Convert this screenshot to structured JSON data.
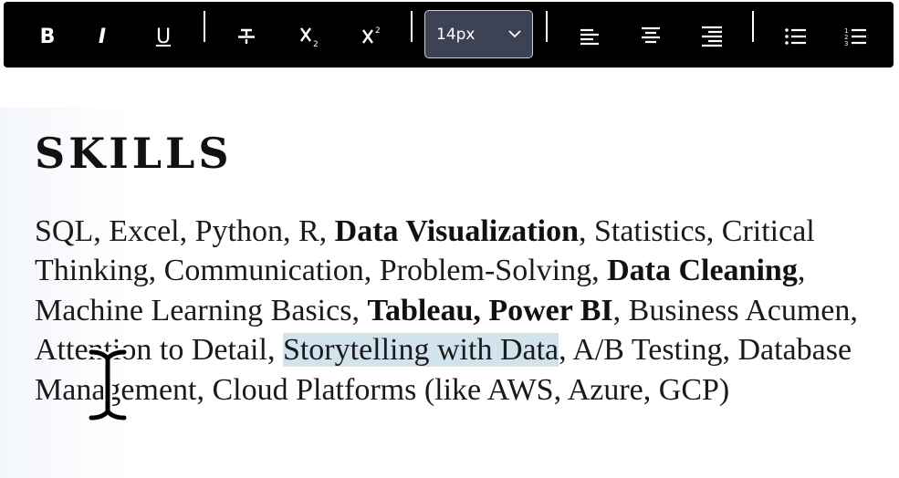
{
  "toolbar": {
    "buttons": {
      "bold": {
        "label": "B"
      },
      "italic": {
        "label": "I"
      },
      "underline": {
        "label": "U"
      },
      "strikethrough": {
        "icon": "strikethrough-icon"
      },
      "subscript": {
        "icon": "subscript-icon"
      },
      "superscript": {
        "icon": "superscript-icon"
      },
      "align_left": {
        "icon": "align-left-icon"
      },
      "align_center": {
        "icon": "align-center-icon"
      },
      "align_right": {
        "icon": "align-right-icon"
      },
      "bullet_list": {
        "icon": "bulleted-list-icon"
      },
      "numbered_list": {
        "icon": "numbered-list-icon"
      }
    },
    "font_size": {
      "value": "14px"
    }
  },
  "document": {
    "heading": "SKILLS",
    "segments": [
      {
        "text": "SQL, Excel, Python, R, ",
        "style": "normal"
      },
      {
        "text": "Data Visualization",
        "style": "bold"
      },
      {
        "text": ", Statistics, Critical Thinking, Communication, Problem-Solving, ",
        "style": "normal"
      },
      {
        "text": "Data Cleaning",
        "style": "bold"
      },
      {
        "text": ", Machine Learning Basics, ",
        "style": "normal"
      },
      {
        "text": "Tableau, Power BI",
        "style": "bold"
      },
      {
        "text": ", Business Acumen, Attention to Detail, ",
        "style": "normal"
      },
      {
        "text": "Storytelling with Data",
        "style": "highlight"
      },
      {
        "text": ", A/B Testing, Database Management, Cloud Platforms (like AWS, Azure, GCP)",
        "style": "normal"
      }
    ]
  },
  "colors": {
    "toolbar_bg": "#000000",
    "select_bg": "#3d4254",
    "highlight": "#d3e3ee"
  }
}
